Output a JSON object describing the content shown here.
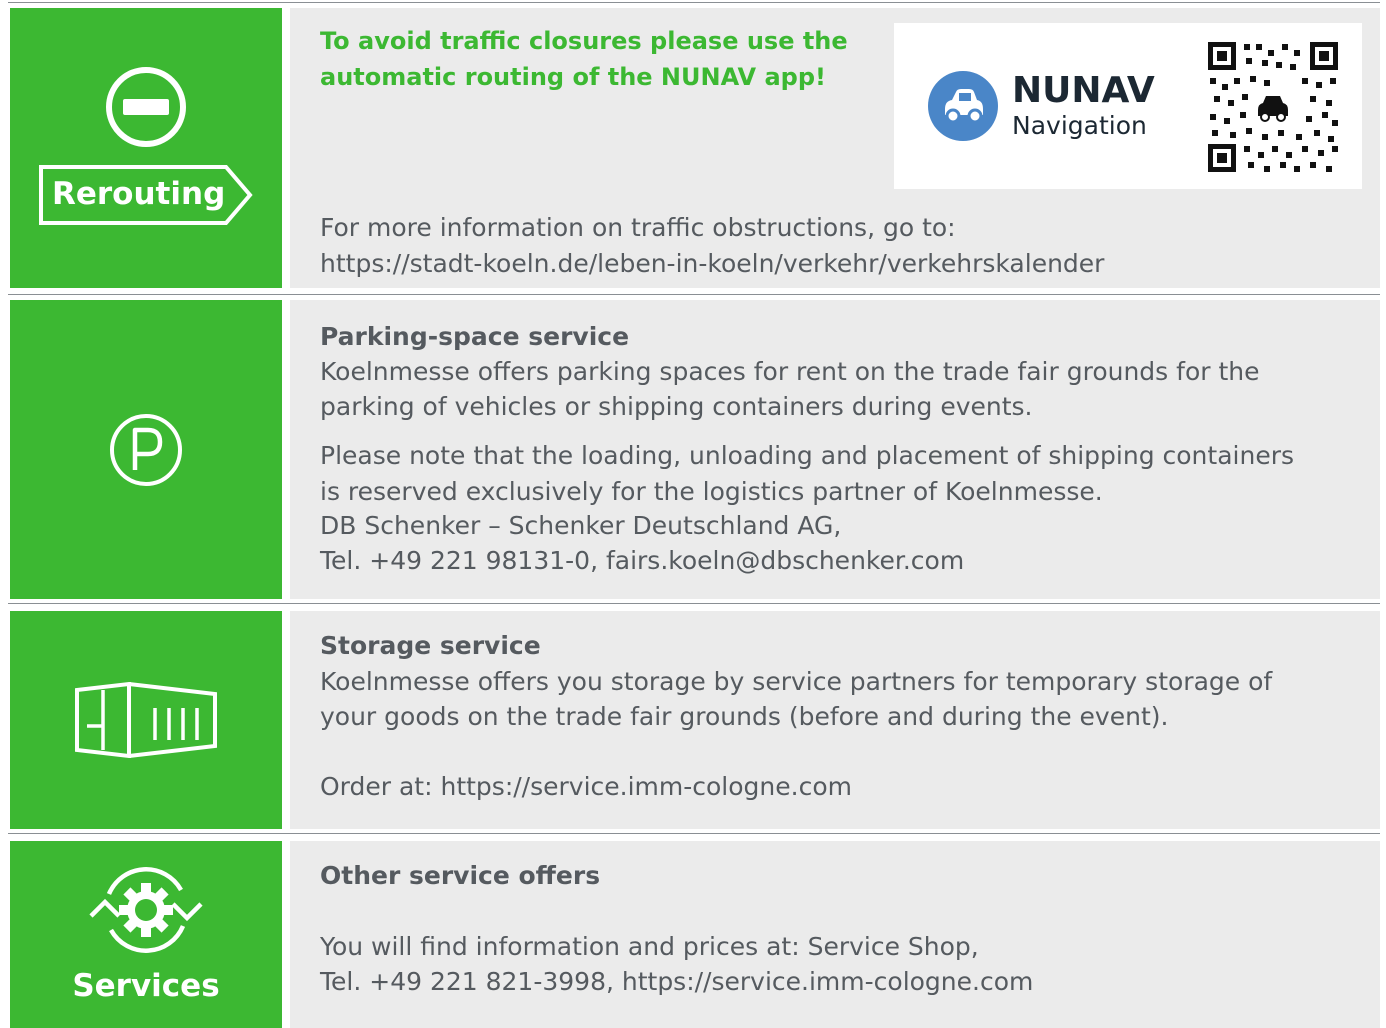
{
  "rerouting": {
    "tile_label": "Rerouting",
    "headline_1": "To avoid traffic closures please use the",
    "headline_2": "automatic routing of the NUNAV app!",
    "brand_name": "NUNAV",
    "brand_sub": "Navigation",
    "info_1": "For more information on traffic obstructions, go to:",
    "info_2": "https://stadt-koeln.de/leben-in-koeln/verkehr/verkehrskalender"
  },
  "parking": {
    "title": "Parking-space service",
    "lines": [
      "Koelnmesse offers parking spaces for rent on the trade fair grounds for the",
      "parking of vehicles or shipping containers during events."
    ],
    "note_lines": [
      "Please note that the loading, unloading and placement of shipping containers",
      "is reserved exclusively for the logistics partner of Koelnmesse.",
      "DB Schenker – Schenker Deutschland AG,",
      "Tel. +49 221 98131-0, fairs.koeln@dbschenker.com"
    ]
  },
  "storage": {
    "title": "Storage service",
    "lines": [
      "Koelnmesse offers you storage by service partners for temporary storage of",
      "your goods on the trade fair grounds (before and during the event)."
    ],
    "order": "Order at: https://service.imm-cologne.com"
  },
  "services": {
    "tile_label": "Services",
    "title": "Other service offers",
    "lines": [
      "You will find information and prices at: Service Shop,",
      "Tel. +49 221 821-3998, https://service.imm-cologne.com"
    ]
  },
  "colors": {
    "accent_green": "#3cb832",
    "panel_gray": "#ebebeb",
    "text_gray": "#555a5f",
    "nunav_blue": "#4a86c8"
  },
  "icons": [
    "no-entry-icon",
    "parking-icon",
    "container-icon",
    "service-gear-icon",
    "car-icon",
    "qr-code-icon"
  ]
}
